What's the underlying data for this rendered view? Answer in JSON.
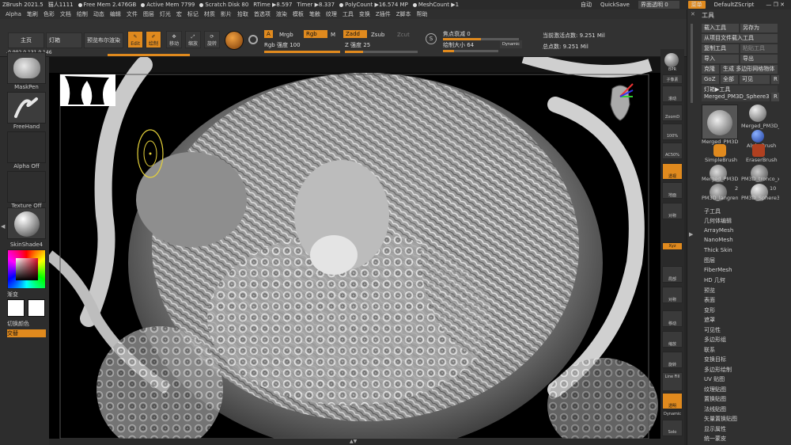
{
  "titlebar": {
    "app": "ZBrush 2021.5",
    "user": "猫人1111",
    "free_mem": "Free Mem 2.476GB",
    "active_mem": "Active Mem 7799",
    "scratch": "Scratch Disk 80",
    "rtime": "RTime ▶8.597",
    "timer": "Timer ▶8.337",
    "polycount": "PolyCount ▶16.574 MP",
    "meshcount": "MeshCount ▶1",
    "auto": "自动",
    "quicksave": "QuickSave",
    "ui_transparency": "界面透明 0",
    "menus": "菜单",
    "script": "DefaultZScript"
  },
  "menubar": {
    "items": [
      "Alpha",
      "笔刷",
      "色彩",
      "文档",
      "绘制",
      "动态",
      "编辑",
      "文件",
      "图层",
      "灯光",
      "宏",
      "标记",
      "材质",
      "影片",
      "拾取",
      "首选项",
      "渲染",
      "模板",
      "笔触",
      "纹理",
      "工具",
      "变换",
      "Z插件",
      "Z脚本",
      "帮助"
    ]
  },
  "toolbar": {
    "home": "主页",
    "lightbox": "灯箱",
    "bpr": "预览布尔渲染",
    "edit": "Edit",
    "draw": "绘制",
    "move": "移动",
    "scale": "缩放",
    "rotate": "旋转",
    "a_label": "A",
    "mrgb": "Mrgb",
    "rgb": "Rgb",
    "m": "M",
    "zadd": "Zadd",
    "zsub": "Zsub",
    "zcut": "Zcut",
    "rgb_intensity": "Rgb 强度 100",
    "z_intensity": "Z 强度 25",
    "focal_shift": "焦点衰减 0",
    "draw_size": "绘制大小 64",
    "dynamic": "Dynamic",
    "active_points": "当前激活点数: 9.251 Mil",
    "total_points": "总点数: 9.251 Mil",
    "coords": "-0.992,0.131,0.146"
  },
  "leftpanel": {
    "brush": "MaskPen",
    "stroke": "FreeHand",
    "alpha": "Alpha Off",
    "texture": "Texture Off",
    "material": "SkinShade4",
    "gradient": "渐变",
    "switch_color": "切换颜色",
    "alternate": "交替",
    "colors": {
      "primary": "#ffffff",
      "secondary": "#ffffff"
    }
  },
  "rightstrip": {
    "items": [
      "BPR",
      "子像素",
      "滚动",
      "ZoomD",
      "100%",
      "AC50%",
      "透视",
      "地面",
      "对称",
      "Xyz",
      "局部",
      "对称",
      "移动",
      "缩放",
      "旋转",
      "Line Fill",
      "透明",
      "Dynamic",
      "Solo"
    ]
  },
  "toolpanel": {
    "title": "工具",
    "load_tool": "载入工具",
    "save_as": "另存为",
    "load_from_project": "从项目文件载入工具",
    "copy_tool": "复制工具",
    "paste_tool": "粘贴工具",
    "import": "导入",
    "export": "导出",
    "clone": "克隆",
    "make_polymesh": "生成 多边形网格物体",
    "goz": "GoZ",
    "all": "全部",
    "visible": "可见",
    "r": "R",
    "lightbox_tools": "灯箱▶工具",
    "current_tool": "Merged_PM3D_Sphere3D1",
    "tools": [
      {
        "name": "Merged_PM3D_",
        "color": "#bbbbbb"
      },
      {
        "name": "Merged_PM3D_S",
        "color": "#aaaaaa"
      },
      {
        "name": "AlphaBrush",
        "color": "#3b6fd6"
      },
      {
        "name": "SimpleBrush",
        "color": "#e08a1e"
      },
      {
        "name": "EraserBrush",
        "color": "#b04020"
      },
      {
        "name": "Merged_PM3D_",
        "color": "#999999"
      },
      {
        "name": "PM3D_tronco_xx",
        "color": "#999999"
      },
      {
        "name": "PM3D_langren1",
        "color": "#999999"
      },
      {
        "name": "PM3D_Sphere3D",
        "color": "#999999"
      }
    ],
    "tool_badges": [
      "2",
      "10"
    ],
    "subtools": [
      "子工具",
      "几何体编辑",
      "ArrayMesh",
      "NanoMesh",
      "Thick Skin",
      "图层",
      "FiberMesh",
      "HD 几何",
      "预览",
      "表面",
      "变形",
      "遮罩",
      "可见性",
      "多边形组",
      "联系",
      "变换目标",
      "多边形绘制",
      "UV 贴图",
      "纹理贴图",
      "置换贴图",
      "法线贴图",
      "矢量置换贴图",
      "显示属性",
      "统一蒙皮"
    ]
  }
}
